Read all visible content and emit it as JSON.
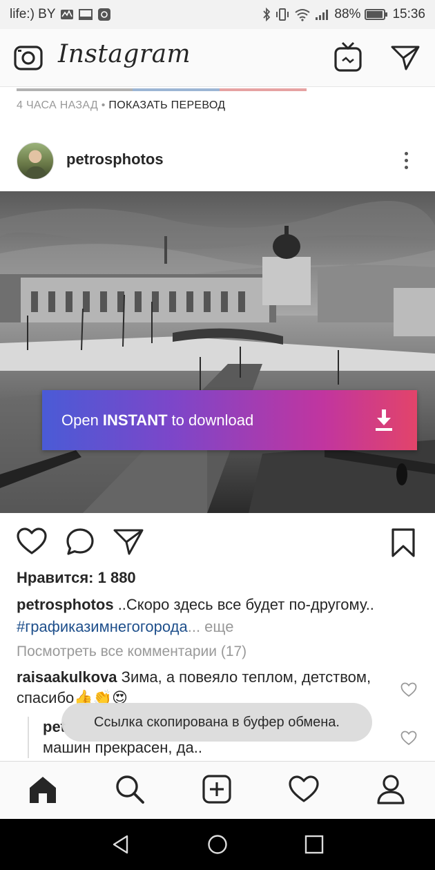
{
  "status": {
    "carrier": "life:) BY",
    "battery": "88%",
    "time": "15:36"
  },
  "app": {
    "title": "Instagram"
  },
  "previous_post": {
    "time_ago": "4 ЧАСА НАЗАД",
    "separator": "•",
    "translate": "ПОКАЗАТЬ ПЕРЕВОД"
  },
  "post": {
    "username": "petrosphotos",
    "banner": {
      "prefix": "Open",
      "strong": "INSTANT",
      "suffix": "to download"
    },
    "likes": "Нравится: 1 880",
    "caption_user": "petrosphotos",
    "caption_text": "..Скоро здесь все будет по-другому..",
    "hashtag": "#графиказимнегогорода",
    "more": "... еще",
    "view_all": "Посмотреть все комментарии (17)",
    "comment1_user": "raisaakulkova",
    "comment1_text": "Зима, а повеяло теплом, детством, спасибо👍👏😍",
    "comment2_user": "pet",
    "comment2_text": "машин прекрасен, да.."
  },
  "toast": "Ссылка скопирована в буфер обмена.",
  "icons": {
    "camera": "camera-icon",
    "igtv": "igtv-icon",
    "direct": "direct-message-icon",
    "like": "heart-icon",
    "comment": "comment-icon",
    "share": "share-icon",
    "save": "bookmark-icon",
    "download": "download-icon"
  },
  "colors": {
    "hashtag": "#1e4f8b",
    "banner_start": "#4a5bd6",
    "banner_end": "#e2446a"
  }
}
